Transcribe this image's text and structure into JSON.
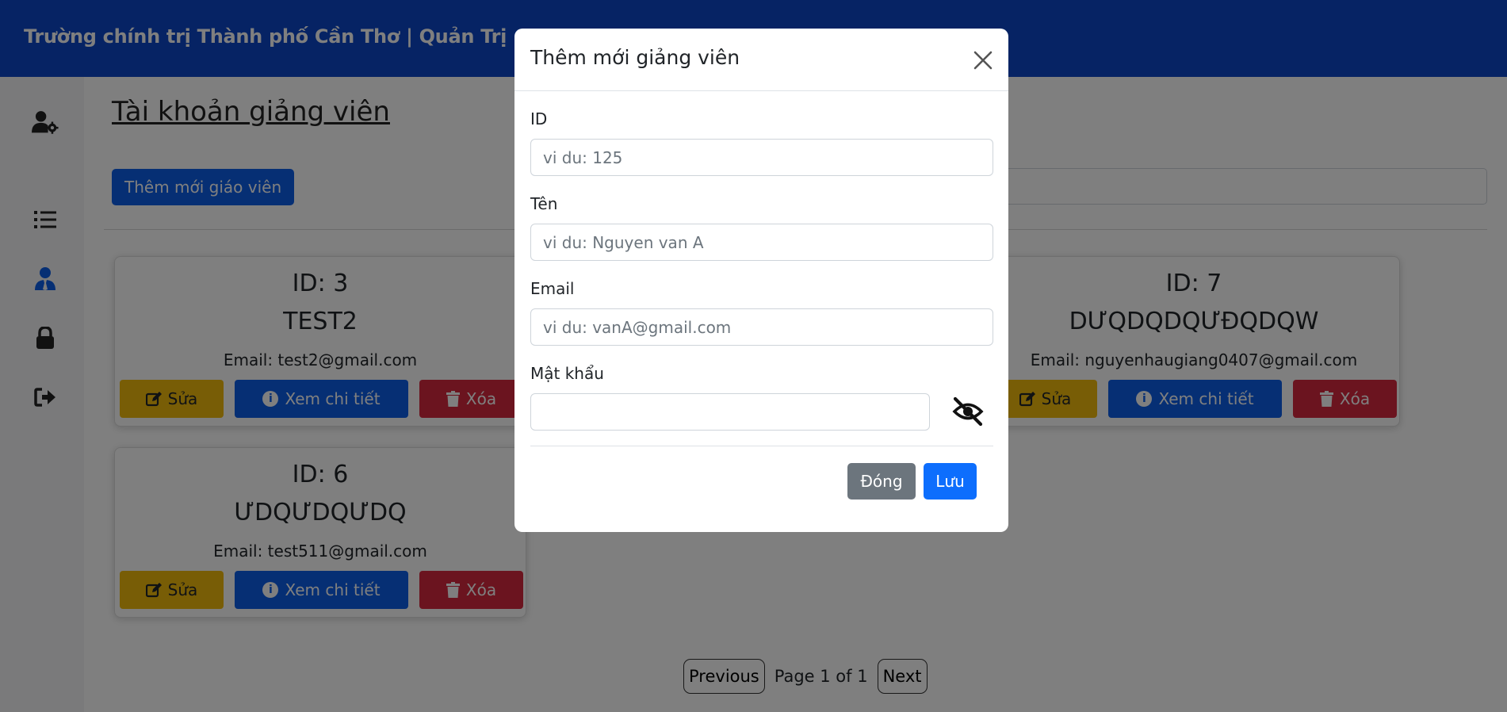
{
  "app": {
    "brand": "Trường chính trị Thành phố Cần Thơ | Quản Trị"
  },
  "sidebar": {
    "items": [
      {
        "icon": "user-gear-icon"
      },
      {
        "icon": "list-icon"
      },
      {
        "icon": "user-tie-icon",
        "active": true
      },
      {
        "icon": "lock-icon"
      },
      {
        "icon": "sign-out-icon"
      }
    ]
  },
  "main": {
    "title": "Tài khoản giảng viên",
    "add_button": "Thêm mới giáo viên",
    "search": {
      "value": "",
      "placeholder": ""
    }
  },
  "cards": [
    {
      "id_label": "ID: 3",
      "name": "TEST2",
      "email": "Email: test2@gmail.com",
      "edit": "Sửa",
      "view": "Xem chi tiết",
      "delete": "Xóa"
    },
    {
      "id_label": "ID: 7",
      "name": "DƯQDQDQƯĐQDQW",
      "email": "Email: nguyenhaugiang0407@gmail.com",
      "edit": "Sửa",
      "view": "Xem chi tiết",
      "delete": "Xóa"
    },
    {
      "id_label": "ID: 6",
      "name": "ƯDQƯDQƯDQ",
      "email": "Email: test511@gmail.com",
      "edit": "Sửa",
      "view": "Xem chi tiết",
      "delete": "Xóa"
    }
  ],
  "pagination": {
    "previous": "Previous",
    "status": "Page 1 of 1",
    "next": "Next"
  },
  "modal": {
    "title": "Thêm mới giảng viên",
    "fields": {
      "id": {
        "label": "ID",
        "placeholder": "vi du: 125",
        "value": ""
      },
      "name": {
        "label": "Tên",
        "placeholder": "vi du: Nguyen van A",
        "value": ""
      },
      "email": {
        "label": "Email",
        "placeholder": "vi du: vanA@gmail.com",
        "value": ""
      },
      "password": {
        "label": "Mật khẩu",
        "placeholder": "",
        "value": ""
      }
    },
    "close_button": "Đóng",
    "save_button": "Lưu"
  },
  "colors": {
    "header": "#0d47c8",
    "primary": "#0d5ee8",
    "warning": "#f1bb0c",
    "danger": "#d7283f",
    "secondary": "#6c757d",
    "overlay": "rgba(0,0,0,0.5)"
  }
}
